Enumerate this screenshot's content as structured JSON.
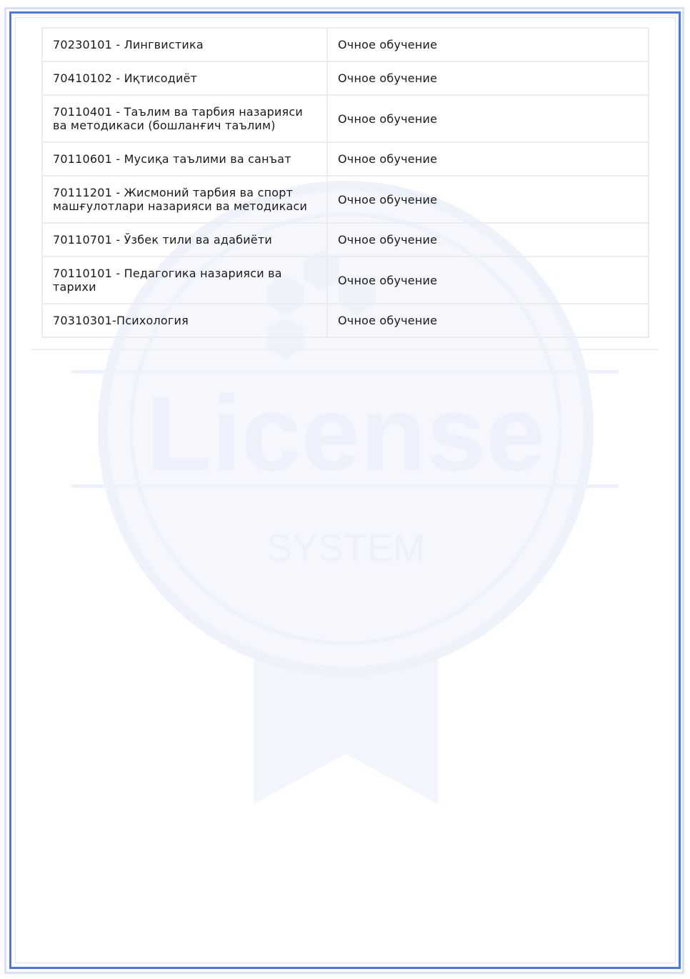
{
  "watermark": {
    "title": "License",
    "subtitle": "SYSTEM"
  },
  "programs": [
    {
      "program": "70230101 - Лингвистика",
      "form": "Очное обучение"
    },
    {
      "program": "70410102 - Иқтисодиёт",
      "form": "Очное обучение"
    },
    {
      "program": "70110401 - Таълим ва тарбия назарияси ва методикаси (бошланғич таълим)",
      "form": "Очное обучение"
    },
    {
      "program": "70110601 - Мусиқа таълими ва санъат",
      "form": "Очное обучение"
    },
    {
      "program": "70111201 - Жисмоний тарбия ва спорт машғулотлари назарияси ва методикаси",
      "form": "Очное обучение"
    },
    {
      "program": "70110701 - Ўзбек тили ва адабиёти",
      "form": "Очное обучение"
    },
    {
      "program": "70110101 - Педагогика назарияси ва тарихи",
      "form": "Очное обучение"
    },
    {
      "program": "70310301-Психология",
      "form": "Очное обучение"
    }
  ],
  "colors": {
    "frame_primary": "#4a78e6",
    "frame_secondary": "#d8e1f7",
    "watermark": "#f1f4fc"
  }
}
